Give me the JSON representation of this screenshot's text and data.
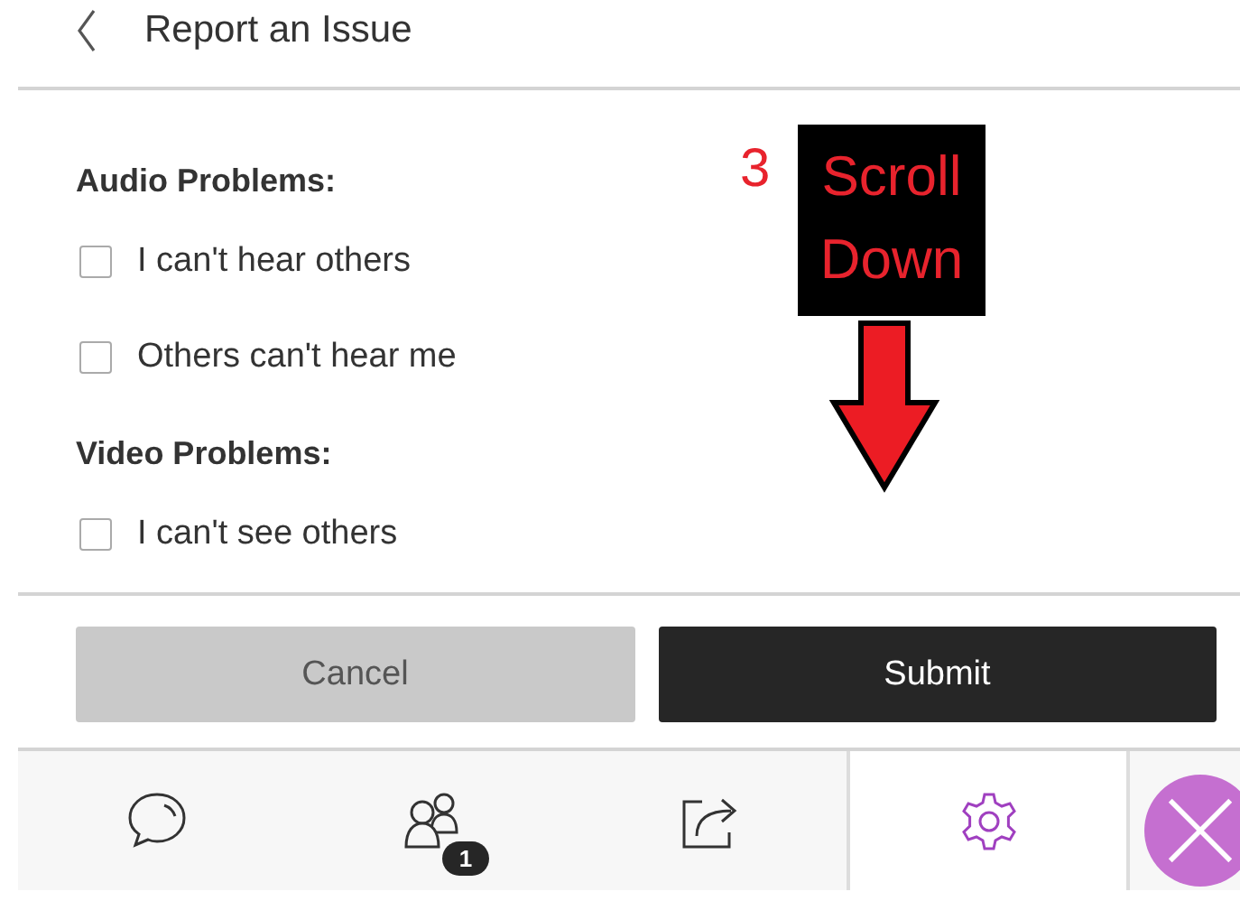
{
  "header": {
    "title": "Report an Issue"
  },
  "sections": [
    {
      "heading": "Audio Problems:",
      "options": [
        {
          "label": "I can't hear others",
          "checked": false
        },
        {
          "label": "Others can't hear me",
          "checked": false
        }
      ]
    },
    {
      "heading": "Video Problems:",
      "options": [
        {
          "label": "I can't see others",
          "checked": false
        }
      ]
    }
  ],
  "annotation": {
    "step": "3",
    "text": "Scroll Down"
  },
  "buttons": [
    {
      "label": "Cancel",
      "kind": "secondary"
    },
    {
      "label": "Submit",
      "kind": "primary"
    }
  ],
  "tabs": [
    {
      "kind": "chat",
      "selected": false
    },
    {
      "kind": "participants",
      "selected": false,
      "badge": "1"
    },
    {
      "kind": "share",
      "selected": false
    },
    {
      "kind": "settings",
      "selected": true
    }
  ],
  "close_button": {
    "kind": "close"
  }
}
